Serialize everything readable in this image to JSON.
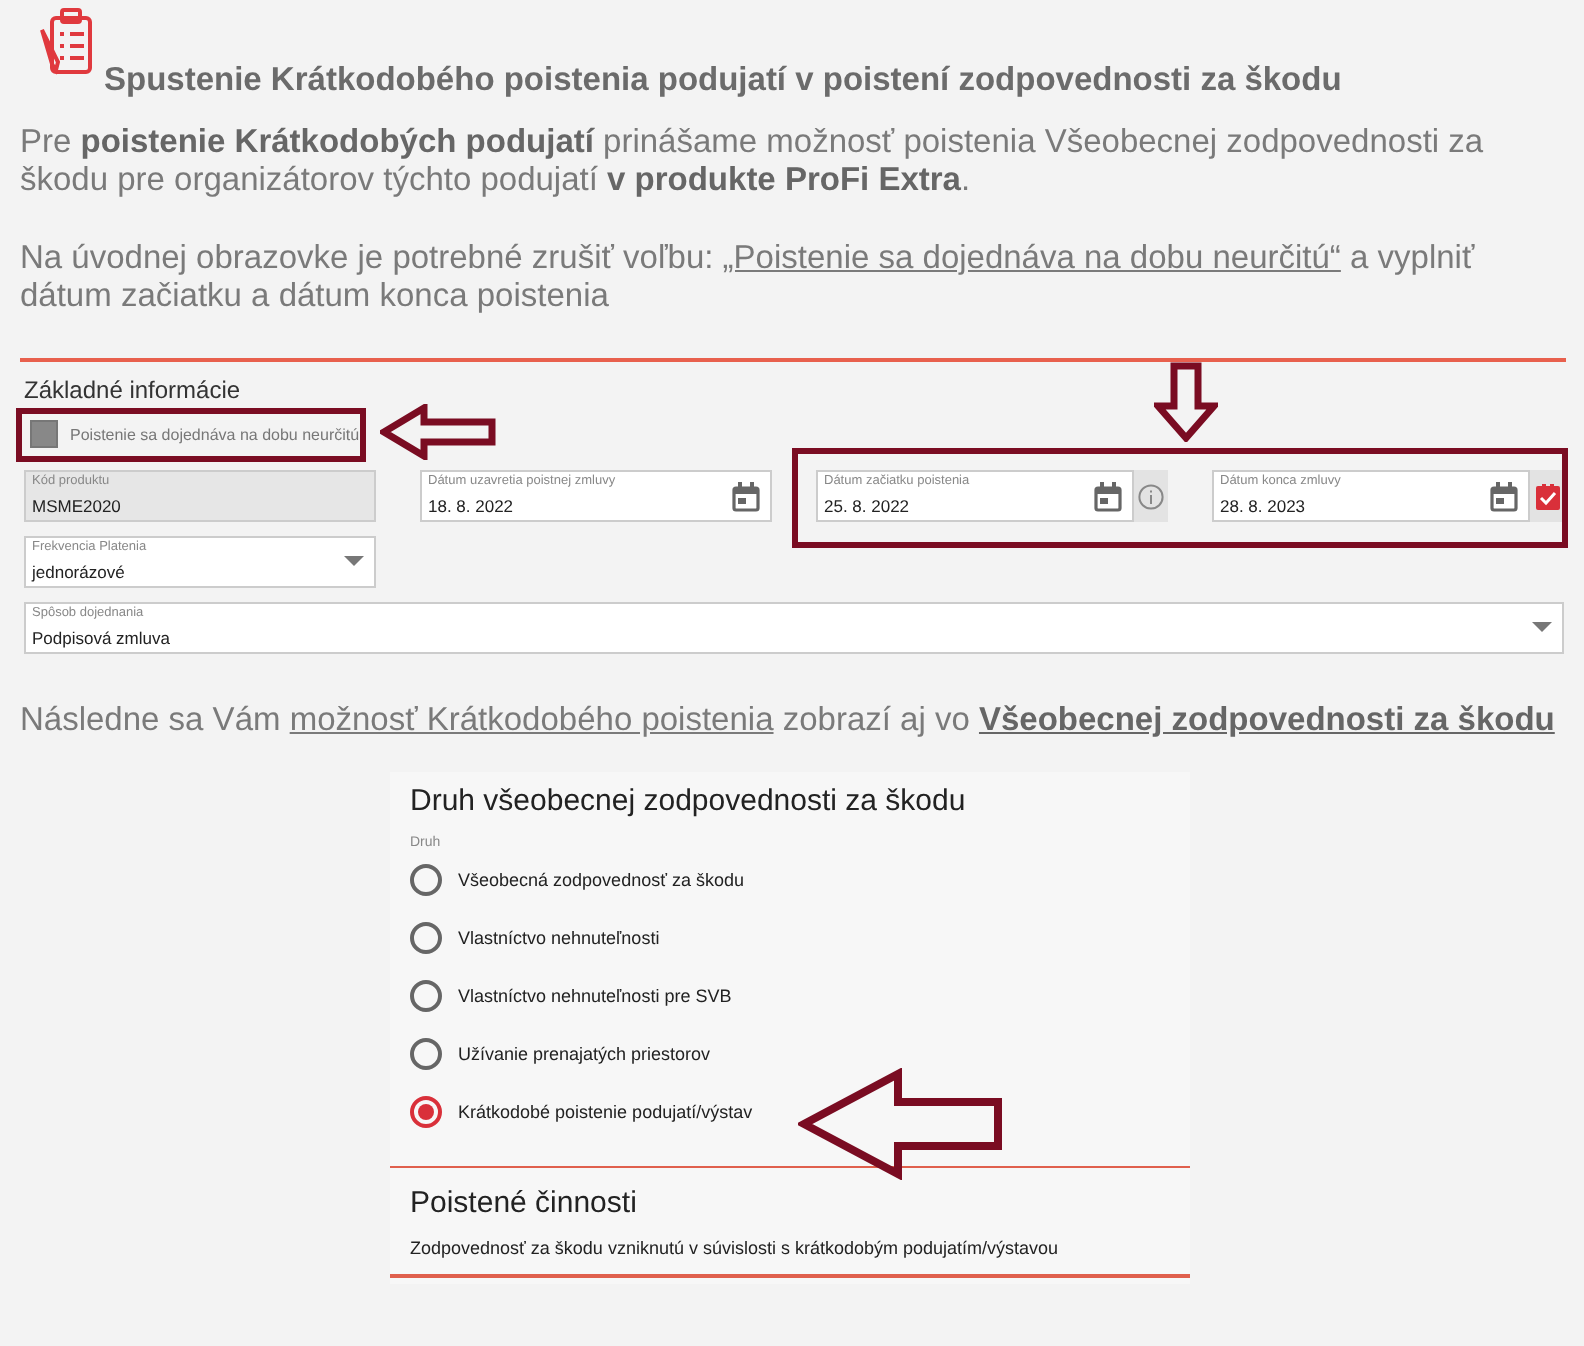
{
  "title": "Spustenie Krátkodobého poistenia podujatí v poistení zodpovednosti za škodu",
  "paragraphs": [
    [
      {
        "text": "Pre ",
        "bold": false,
        "underline": false
      },
      {
        "text": "poistenie Krátkodobých podujatí",
        "bold": true,
        "underline": false
      },
      {
        "text": " prinášame možnosť poistenia Všeobecnej zodpovednosti za škodu pre organizátorov týchto podujatí ",
        "bold": false,
        "underline": false
      },
      {
        "text": "v produkte ProFi Extra",
        "bold": true,
        "underline": false
      },
      {
        "text": ".",
        "bold": false,
        "underline": false
      }
    ],
    [
      {
        "text": "Na úvodnej obrazovke je potrebné zrušiť voľbu: ",
        "bold": false,
        "underline": false
      },
      {
        "text": "„Poistenie sa dojednáva na dobu neurčitú“",
        "bold": false,
        "underline": true
      },
      {
        "text": " a vyplniť dátum začiatku a dátum konca poistenia",
        "bold": false,
        "underline": false
      }
    ]
  ],
  "form": {
    "heading": "Základné informácie",
    "checkbox": {
      "label": "Poistenie sa dojednáva na dobu neurčitú",
      "checked": false,
      "disabled": true
    },
    "fields": [
      {
        "kind": "text",
        "label": "Kód produktu",
        "value": "MSME2020",
        "disabled": true
      },
      {
        "kind": "date",
        "label": "Dátum uzavretia poistnej zmluvy",
        "value": "18. 8. 2022",
        "disabled": false
      },
      {
        "kind": "date",
        "label": "Dátum začiatku poistenia",
        "value": "25. 8. 2022",
        "disabled": false,
        "addon": {
          "kind": "info"
        }
      },
      {
        "kind": "date",
        "label": "Dátum konca zmluvy",
        "value": "28. 8. 2023",
        "disabled": false,
        "addon": {
          "kind": "check"
        }
      },
      {
        "kind": "select",
        "label": "Frekvencia Platenia",
        "value": "jednorázové",
        "disabled": false
      },
      {
        "kind": "select",
        "label": "Spôsob dojednania",
        "value": "Podpisová zmluva",
        "disabled": false,
        "wide": true
      }
    ]
  },
  "sentence": [
    {
      "text": "Následne sa Vám ",
      "bold": false,
      "underline": false
    },
    {
      "text": "možnosť Krátkodobého poistenia",
      "bold": false,
      "underline": true
    },
    {
      "text": " zobrazí aj vo ",
      "bold": false,
      "underline": false
    },
    {
      "text": "Všeobecnej zodpovednosti za škodu",
      "bold": true,
      "underline": true
    }
  ],
  "liability": {
    "heading": "Druh všeobecnej zodpovednosti za škodu",
    "group_label": "Druh",
    "options": [
      {
        "label": "Všeobecná zodpovednosť za škodu",
        "selected": false
      },
      {
        "label": "Vlastníctvo nehnuteľnosti",
        "selected": false
      },
      {
        "label": "Vlastníctvo nehnuteľnosti pre SVB",
        "selected": false
      },
      {
        "label": "Užívanie prenajatých priestorov",
        "selected": false
      },
      {
        "label": "Krátkodobé poistenie podujatí/výstav",
        "selected": true
      }
    ],
    "activities_heading": "Poistené činnosti",
    "activities_text": "Zodpovednosť za škodu vzniknutú v súvislosti s krátkodobým podujatím/výstavou"
  }
}
